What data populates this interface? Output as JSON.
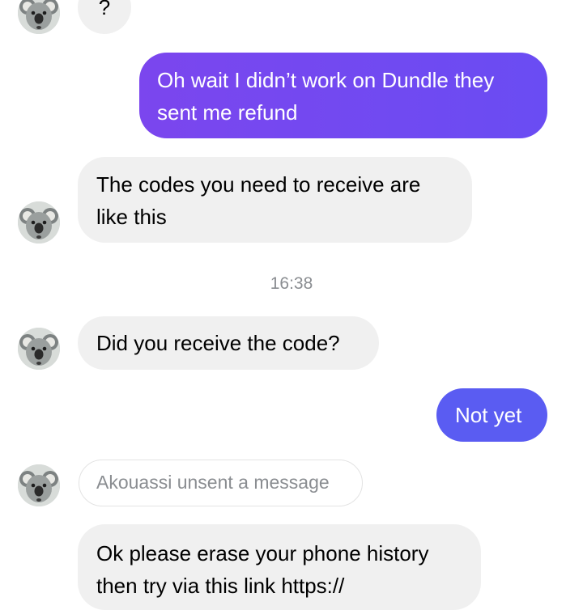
{
  "messages": {
    "first_question": "?",
    "refund_msg_line1": "Oh wait I didn’t work on Dundle they",
    "refund_msg_line2": "sent me refund",
    "codes_msg_line1": "The codes you need to receive are",
    "codes_msg_line2": "like this",
    "timestamp": "16:38",
    "receive_code_msg": "Did you receive the code?",
    "not_yet_msg": "Not yet",
    "unsent_notice": "Akouassi unsent a message",
    "erase_msg_line1": "Ok please erase your phone history",
    "erase_msg_line2": "then try via this link https://"
  },
  "colors": {
    "outgoing_primary": "#6f48f0",
    "outgoing_secondary": "#5a5cf2",
    "incoming_bubble": "#f0f0f0"
  },
  "icons": {
    "avatar": "koala-avatar-icon"
  }
}
